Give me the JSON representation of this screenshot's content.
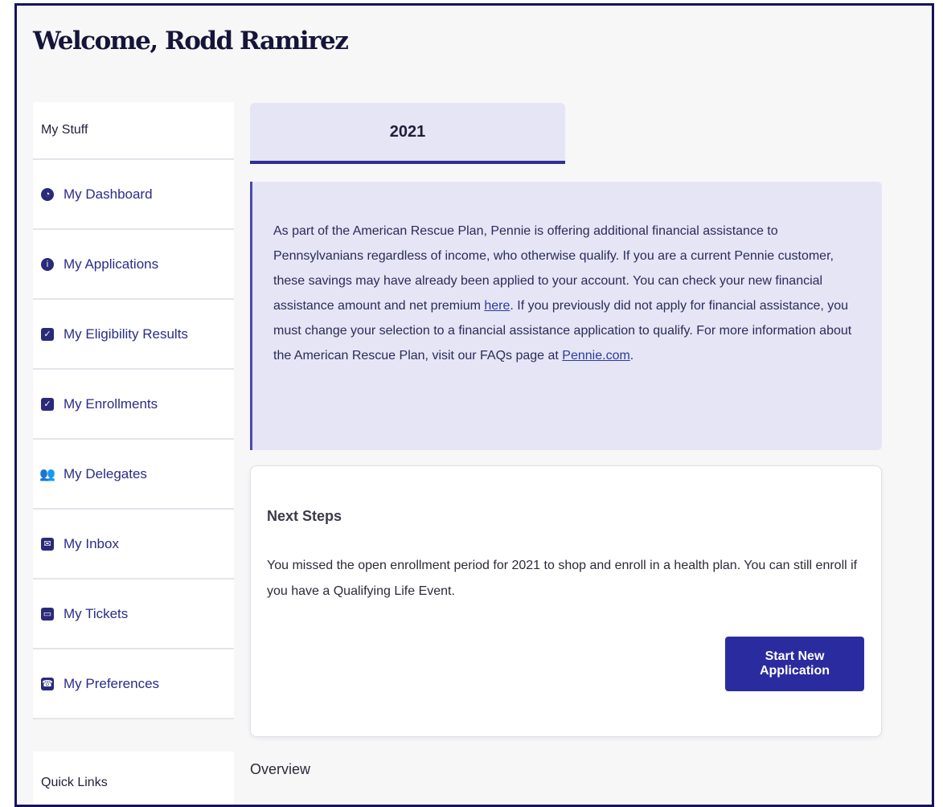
{
  "header": {
    "welcome": "Welcome, Rodd Ramirez"
  },
  "sidebar": {
    "heading": "My Stuff",
    "items": [
      {
        "label": "My Dashboard",
        "icon": "dashboard-icon"
      },
      {
        "label": "My Applications",
        "icon": "info-icon"
      },
      {
        "label": "My Eligibility Results",
        "icon": "clipboard-check-icon"
      },
      {
        "label": "My Enrollments",
        "icon": "checkbox-icon"
      },
      {
        "label": "My Delegates",
        "icon": "users-icon"
      },
      {
        "label": "My Inbox",
        "icon": "envelope-icon"
      },
      {
        "label": "My Tickets",
        "icon": "ticket-icon"
      },
      {
        "label": "My Preferences",
        "icon": "phone-icon"
      }
    ],
    "quick_links": "Quick Links"
  },
  "main": {
    "tab_year": "2021",
    "banner": {
      "part1": "As part of the American Rescue Plan, Pennie is offering additional financial assistance to Pennsylvanians regardless of income, who otherwise qualify. If you are a current Pennie customer, these savings may have already been applied to your account. You can check your new financial assistance amount and net premium ",
      "link1": "here",
      "part2": ". If you previously did not apply for financial assistance, you must change your selection to a financial assistance application to qualify. For more information about the American Rescue Plan, visit our FAQs page at ",
      "link2": "Pennie.com",
      "part3": "."
    },
    "next_steps": {
      "title": "Next Steps",
      "text": "You missed the open enrollment period for 2021 to shop and enroll in a health plan. You can still enroll if you have a Qualifying Life Event.",
      "button": "Start New Application"
    },
    "overview": "Overview"
  },
  "colors": {
    "accent": "#2b2ba0",
    "banner_bg": "#e5e5f5",
    "frame_border": "#14145a"
  }
}
